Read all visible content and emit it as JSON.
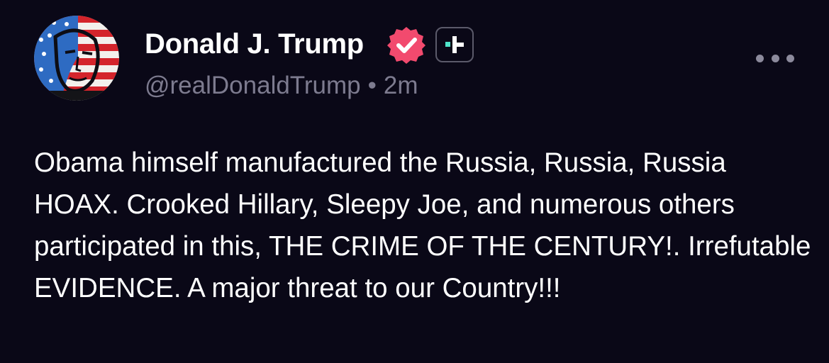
{
  "post": {
    "display_name": "Donald J. Trump",
    "handle": "@realDonaldTrump",
    "separator": "•",
    "timestamp": "2m",
    "body": "Obama himself manufactured the Russia, Russia, Russia HOAX. Crooked Hillary, Sleepy Joe, and numerous others participated in this, THE CRIME OF THE CENTURY!. Irrefutable EVIDENCE. A major threat to our Country!!!",
    "avatar_icon": "avatar-flag-portrait",
    "verified_icon": "verified-badge-icon",
    "plus_icon": "plus-badge-icon",
    "more_icon": "more-options-icon"
  },
  "colors": {
    "background": "#0a0817",
    "text": "#ffffff",
    "muted": "#7d7b8f",
    "verified": "#f24a6e",
    "plus_accent": "#4fe3c9"
  }
}
